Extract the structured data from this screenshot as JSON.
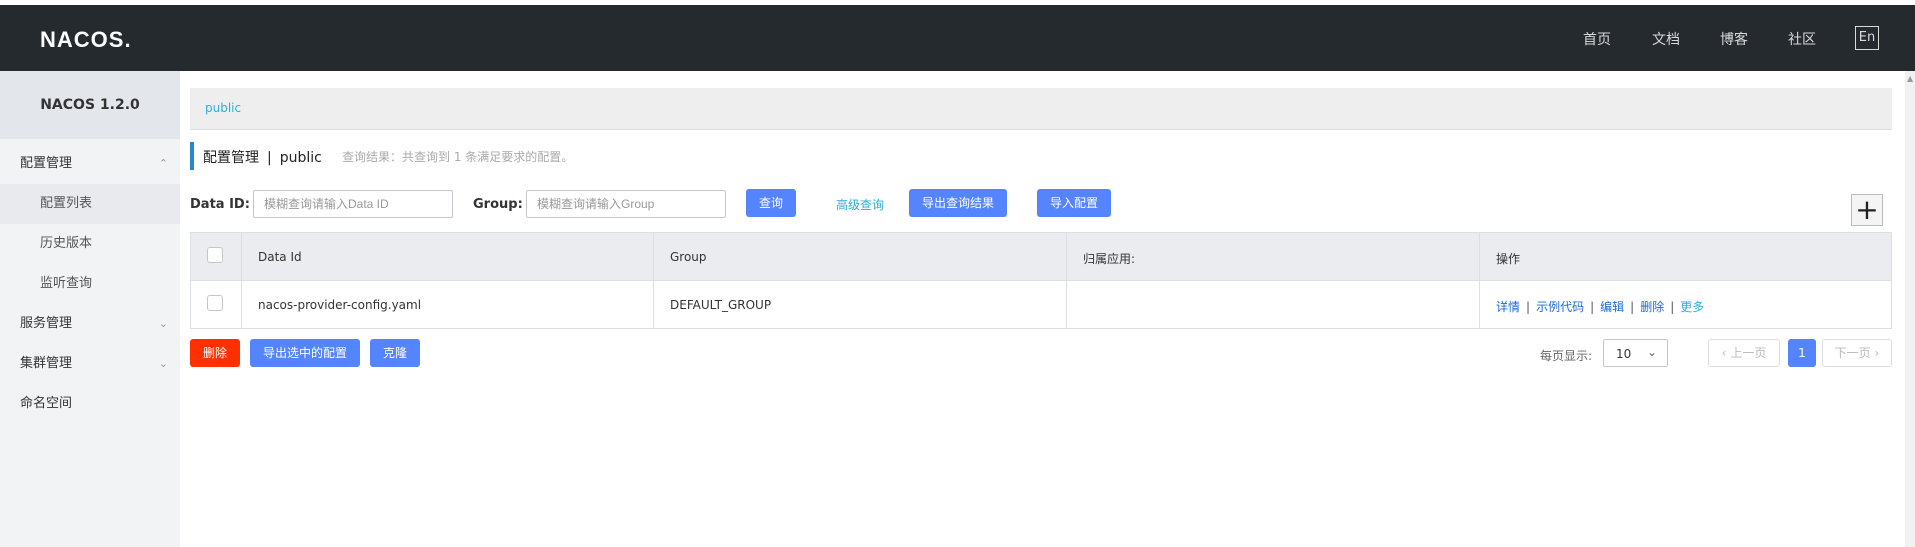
{
  "header": {
    "logo_text": "NACOS.",
    "nav": [
      "首页",
      "文档",
      "博客",
      "社区"
    ],
    "lang_button": "En"
  },
  "sidebar": {
    "version": "NACOS 1.2.0",
    "items": [
      {
        "label": "配置管理",
        "icon": "chevron-up-icon"
      },
      {
        "label": "配置列表"
      },
      {
        "label": "历史版本"
      },
      {
        "label": "监听查询"
      },
      {
        "label": "服务管理",
        "icon": "chevron-down-icon"
      },
      {
        "label": "集群管理",
        "icon": "chevron-down-icon"
      },
      {
        "label": "命名空间"
      }
    ]
  },
  "breadcrumb": {
    "namespace": "public"
  },
  "page": {
    "title": "配置管理",
    "separator": "|",
    "namespace": "public",
    "result_text": "查询结果：共查询到 1 条满足要求的配置。"
  },
  "search": {
    "dataid_label": "Data ID:",
    "dataid_placeholder": "模糊查询请输入Data ID",
    "group_label": "Group:",
    "group_placeholder": "模糊查询请输入Group",
    "query_button": "查询",
    "advanced_link": "高级查询",
    "export_button": "导出查询结果",
    "import_button": "导入配置",
    "add_icon": "plus-icon"
  },
  "table": {
    "headers": [
      "Data Id",
      "Group",
      "归属应用:",
      "操作"
    ],
    "rows": [
      {
        "data_id": "nacos-provider-config.yaml",
        "group": "DEFAULT_GROUP",
        "app": "",
        "actions": [
          "详情",
          "示例代码",
          "编辑",
          "删除",
          "更多"
        ]
      }
    ]
  },
  "bottom": {
    "delete_button": "删除",
    "export_selected_button": "导出选中的配置",
    "clone_button": "克隆"
  },
  "pagination": {
    "per_page_label": "每页显示:",
    "per_page_value": "10",
    "prev": "上一页",
    "current": "1",
    "next": "下一页"
  },
  "colors": {
    "header_bg": "#252a2f",
    "primary": "#5584ff",
    "danger": "#ff3000",
    "link": "#2ab0d8"
  }
}
